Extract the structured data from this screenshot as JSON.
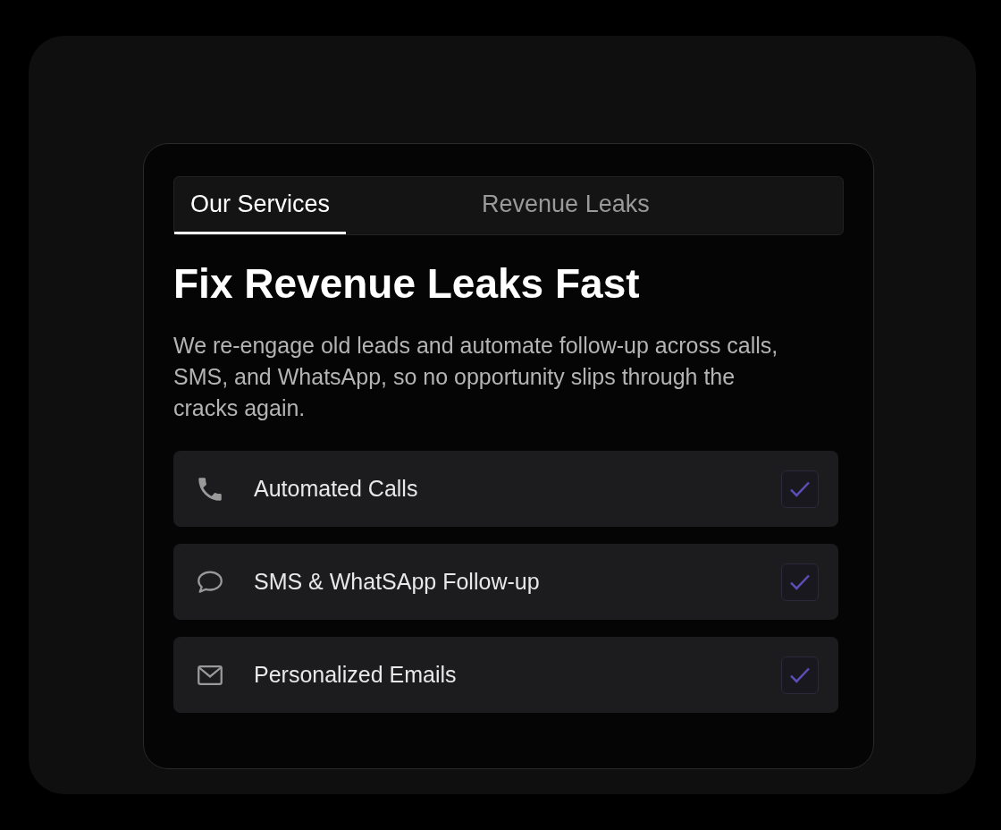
{
  "tabs": [
    {
      "label": "Our Services",
      "selected": true
    },
    {
      "label": "Revenue Leaks",
      "selected": false
    }
  ],
  "heading": "Fix Revenue Leaks Fast",
  "description": "We re-engage old leads and automate follow-up across calls, SMS, and WhatsApp, so no opportunity slips through the cracks again.",
  "services": [
    {
      "kind": "phone",
      "label": "Automated Calls",
      "checked": true
    },
    {
      "kind": "chat",
      "label": "SMS & WhatSApp Follow-up",
      "checked": true
    },
    {
      "kind": "mail",
      "label": "Personalized Emails",
      "checked": true
    }
  ]
}
